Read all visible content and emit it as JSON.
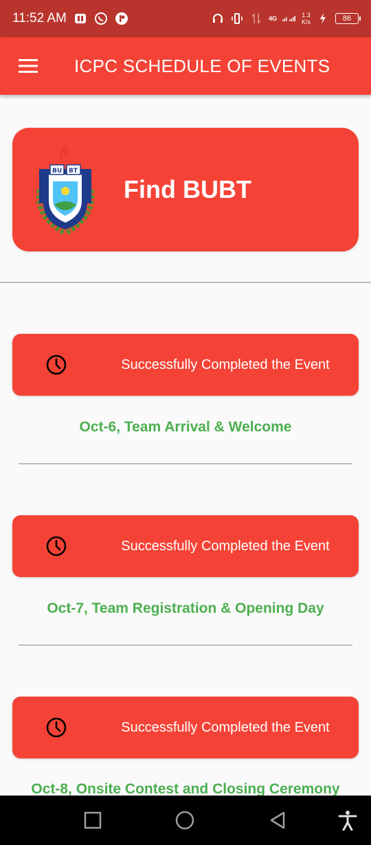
{
  "status_bar": {
    "time": "11:52 AM",
    "network": "4G",
    "net_speed_top": "1.3",
    "net_speed_bottom": "K/s",
    "battery": "86"
  },
  "app_bar": {
    "title": "ICPC SCHEDULE OF EVENTS"
  },
  "find_card": {
    "label": "Find BUBT"
  },
  "events": [
    {
      "button_label": "Successfully Completed the Event",
      "caption": "Oct-6, Team Arrival & Welcome"
    },
    {
      "button_label": "Successfully Completed the Event",
      "caption": "Oct-7, Team Registration & Opening Day"
    },
    {
      "button_label": "Successfully Completed the Event",
      "caption": "Oct-8, Onsite Contest and Closing Ceremony"
    }
  ],
  "colors": {
    "accent": "#f44336",
    "status_bar": "#b8342c",
    "caption_green": "#4caf50"
  }
}
